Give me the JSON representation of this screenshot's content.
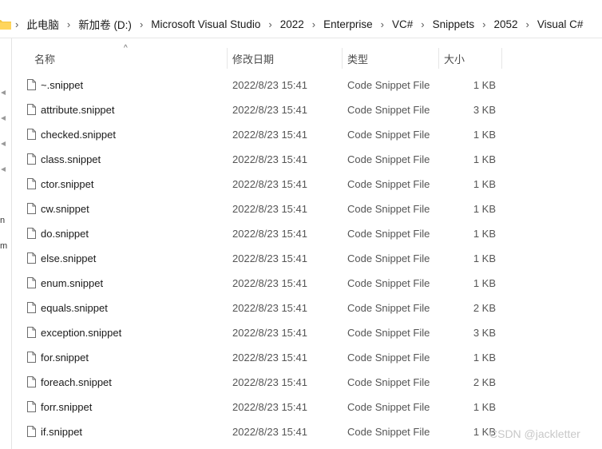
{
  "breadcrumb": [
    "此电脑",
    "新加卷 (D:)",
    "Microsoft Visual Studio",
    "2022",
    "Enterprise",
    "VC#",
    "Snippets",
    "2052",
    "Visual C#"
  ],
  "columns": {
    "name": "名称",
    "date": "修改日期",
    "type": "类型",
    "size": "大小"
  },
  "left_pane": {
    "labels": [
      "n",
      "m"
    ]
  },
  "files": [
    {
      "name": "~.snippet",
      "date": "2022/8/23 15:41",
      "type": "Code Snippet File",
      "size": "1 KB"
    },
    {
      "name": "attribute.snippet",
      "date": "2022/8/23 15:41",
      "type": "Code Snippet File",
      "size": "3 KB"
    },
    {
      "name": "checked.snippet",
      "date": "2022/8/23 15:41",
      "type": "Code Snippet File",
      "size": "1 KB"
    },
    {
      "name": "class.snippet",
      "date": "2022/8/23 15:41",
      "type": "Code Snippet File",
      "size": "1 KB"
    },
    {
      "name": "ctor.snippet",
      "date": "2022/8/23 15:41",
      "type": "Code Snippet File",
      "size": "1 KB"
    },
    {
      "name": "cw.snippet",
      "date": "2022/8/23 15:41",
      "type": "Code Snippet File",
      "size": "1 KB"
    },
    {
      "name": "do.snippet",
      "date": "2022/8/23 15:41",
      "type": "Code Snippet File",
      "size": "1 KB"
    },
    {
      "name": "else.snippet",
      "date": "2022/8/23 15:41",
      "type": "Code Snippet File",
      "size": "1 KB"
    },
    {
      "name": "enum.snippet",
      "date": "2022/8/23 15:41",
      "type": "Code Snippet File",
      "size": "1 KB"
    },
    {
      "name": "equals.snippet",
      "date": "2022/8/23 15:41",
      "type": "Code Snippet File",
      "size": "2 KB"
    },
    {
      "name": "exception.snippet",
      "date": "2022/8/23 15:41",
      "type": "Code Snippet File",
      "size": "3 KB"
    },
    {
      "name": "for.snippet",
      "date": "2022/8/23 15:41",
      "type": "Code Snippet File",
      "size": "1 KB"
    },
    {
      "name": "foreach.snippet",
      "date": "2022/8/23 15:41",
      "type": "Code Snippet File",
      "size": "2 KB"
    },
    {
      "name": "forr.snippet",
      "date": "2022/8/23 15:41",
      "type": "Code Snippet File",
      "size": "1 KB"
    },
    {
      "name": "if.snippet",
      "date": "2022/8/23 15:41",
      "type": "Code Snippet File",
      "size": "1 KB"
    }
  ],
  "watermark": "CSDN @jackletter",
  "icons": {
    "folder": "folder-icon",
    "file": "file-icon",
    "pin": "pin-icon",
    "sort": "sort-ascending-icon"
  }
}
